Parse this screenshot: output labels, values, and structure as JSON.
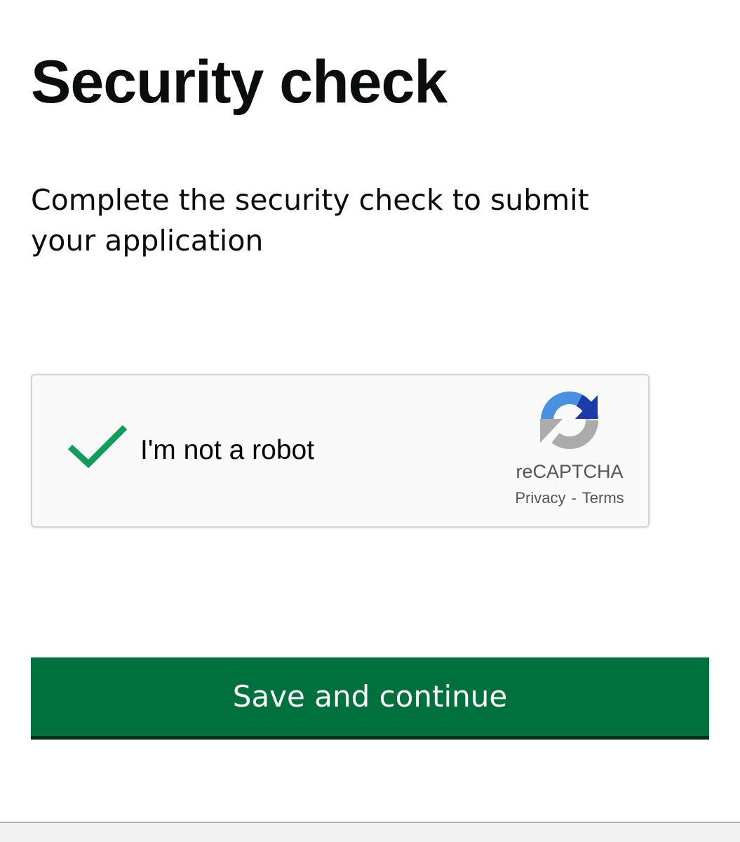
{
  "page": {
    "title": "Security check",
    "lead": "Complete the security check to submit your application"
  },
  "recaptcha": {
    "checkbox_label": "I'm not a robot",
    "checked": true,
    "brand": "reCAPTCHA",
    "privacy_link": "Privacy",
    "separator": "-",
    "terms_link": "Terms",
    "check_color": "#0f9d58"
  },
  "form": {
    "submit_label": "Save and continue",
    "submit_color": "#00703c"
  }
}
